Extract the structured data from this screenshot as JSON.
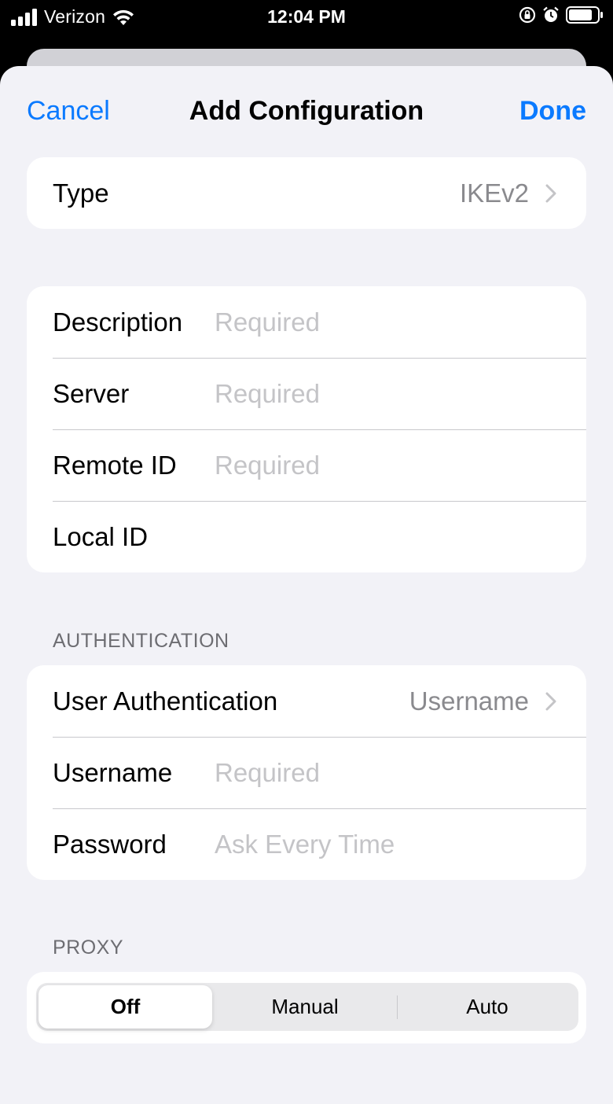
{
  "status": {
    "carrier": "Verizon",
    "time": "12:04 PM"
  },
  "nav": {
    "cancel": "Cancel",
    "title": "Add Configuration",
    "done": "Done"
  },
  "type_row": {
    "label": "Type",
    "value": "IKEv2"
  },
  "connection": {
    "description": {
      "label": "Description",
      "placeholder": "Required"
    },
    "server": {
      "label": "Server",
      "placeholder": "Required"
    },
    "remote_id": {
      "label": "Remote ID",
      "placeholder": "Required"
    },
    "local_id": {
      "label": "Local ID",
      "placeholder": ""
    }
  },
  "authentication": {
    "header": "AUTHENTICATION",
    "user_auth": {
      "label": "User Authentication",
      "value": "Username"
    },
    "username": {
      "label": "Username",
      "placeholder": "Required"
    },
    "password": {
      "label": "Password",
      "placeholder": "Ask Every Time"
    }
  },
  "proxy": {
    "header": "PROXY",
    "options": [
      "Off",
      "Manual",
      "Auto"
    ],
    "selected": "Off"
  },
  "colors": {
    "accent": "#0a7aff",
    "background": "#f2f2f7",
    "placeholder": "#c4c4c7",
    "secondary_text": "#8a8a8e"
  }
}
